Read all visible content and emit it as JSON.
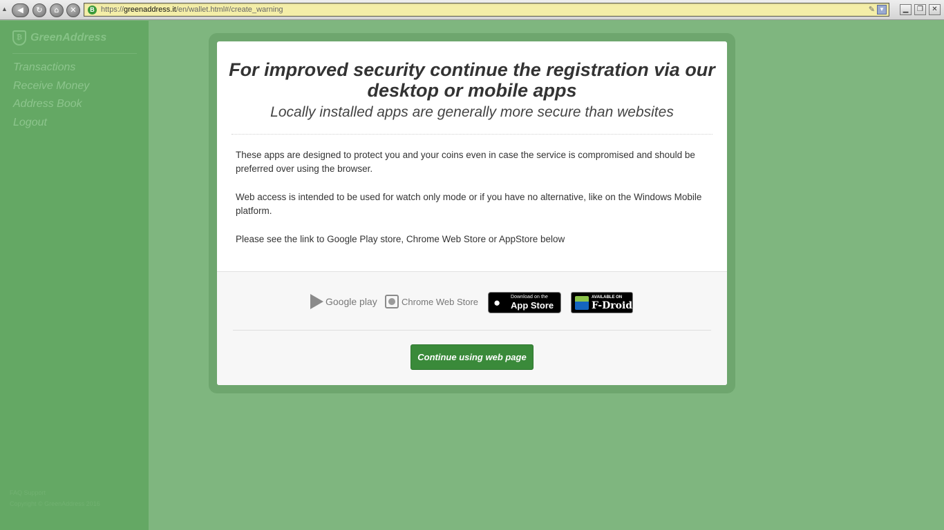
{
  "browser": {
    "url_scheme": "https://",
    "url_host": "greenaddress.it",
    "url_path": "/en/wallet.html#/create_warning",
    "favicon_letter": "B",
    "icons": [
      "back-icon",
      "reload-icon",
      "home-icon",
      "stop-icon",
      "bookmark-pencil-icon",
      "history-dropdown-icon",
      "minimize-icon",
      "maximize-icon",
      "close-icon"
    ]
  },
  "sidebar": {
    "brand": "GreenAddress",
    "items": [
      {
        "label": "Transactions"
      },
      {
        "label": "Receive Money"
      },
      {
        "label": "Address Book"
      },
      {
        "label": "Logout"
      }
    ],
    "footer_links": "FAQ  Support",
    "copyright": "Copyright © GreenAddress 2016"
  },
  "modal": {
    "title": "For improved security continue the registration via our desktop or mobile apps",
    "subtitle": "Locally installed apps are generally more secure than websites",
    "paragraphs": [
      "These apps are designed to protect you and your coins even in case the service is compromised and should be preferred over using the browser.",
      "Web access is intended to be used for watch only mode or if you have no alternative, like on the Windows Mobile platform.",
      "Please see the link to Google Play store, Chrome Web Store or AppStore below"
    ],
    "stores": {
      "google_play": "Google play",
      "chrome_web_store": "Chrome Web Store",
      "app_store_small": "Download on the",
      "app_store_big": "App Store",
      "fdroid_small": "AVAILABLE ON",
      "fdroid_big": "F-Droid"
    },
    "continue_button": "Continue using web page"
  },
  "colors": {
    "background": "#7fb67f",
    "sidebar": "#64a864",
    "button": "#3a8a3a"
  }
}
